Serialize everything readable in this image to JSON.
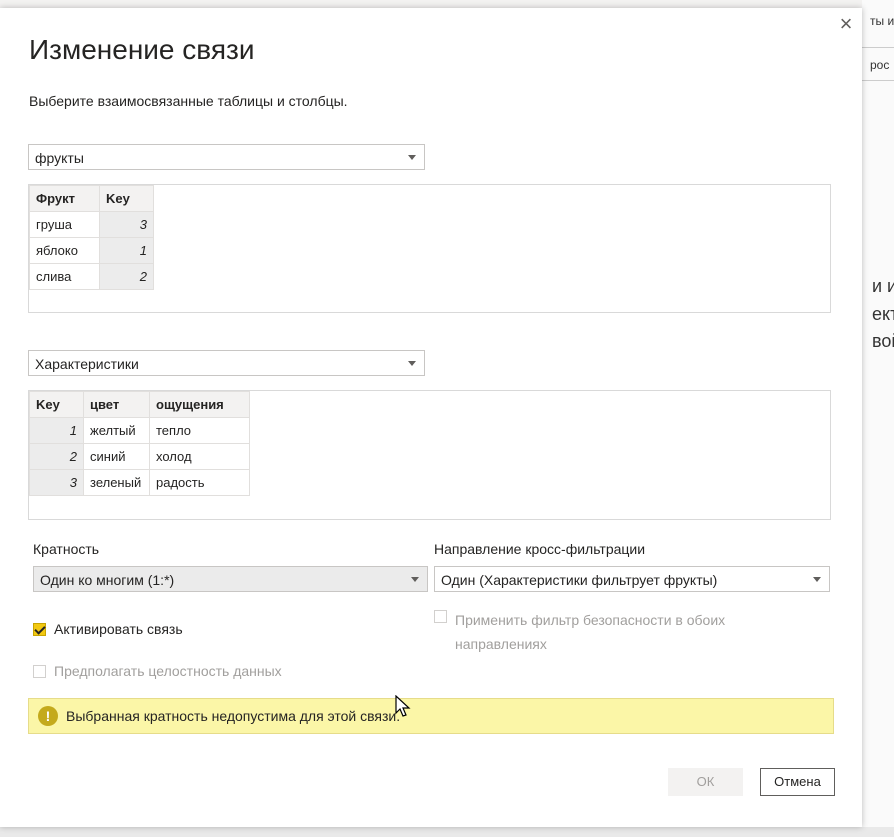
{
  "background": {
    "right_small": "ты и",
    "right_small2": "рос",
    "right_lines": [
      "и ил",
      "ект",
      "вой"
    ]
  },
  "dialog": {
    "close_glyph": "×",
    "title": "Изменение связи",
    "subtitle": "Выберите взаимосвязанные таблицы и столбцы."
  },
  "table1": {
    "select_value": "фрукты",
    "headers": [
      "Фрукт",
      "Key"
    ],
    "rows": [
      [
        "груша",
        "3"
      ],
      [
        "яблоко",
        "1"
      ],
      [
        "слива",
        "2"
      ]
    ]
  },
  "table2": {
    "select_value": "Характеристики",
    "headers": [
      "Key",
      "цвет",
      "ощущения"
    ],
    "rows": [
      [
        "1",
        "желтый",
        "тепло"
      ],
      [
        "2",
        "синий",
        "холод"
      ],
      [
        "3",
        "зеленый",
        "радость"
      ]
    ]
  },
  "cardinality": {
    "label": "Кратность",
    "value": "Один ко многим (1:*)"
  },
  "crossfilter": {
    "label": "Направление кросс-фильтрации",
    "value": "Один (Характеристики фильтрует фрукты)"
  },
  "options": {
    "activate": "Активировать связь",
    "activate_checked": true,
    "integrity": "Предполагать целостность данных",
    "security_line1": "Применить фильтр безопасности в обоих",
    "security_line2": "направлениях"
  },
  "warning": {
    "icon": "!",
    "text": "Выбранная кратность недопустима для этой связи."
  },
  "buttons": {
    "ok": "ОК",
    "cancel": "Отмена"
  },
  "colors": {
    "accent": "#f2c811",
    "warning_bg": "#fbf6a7"
  }
}
